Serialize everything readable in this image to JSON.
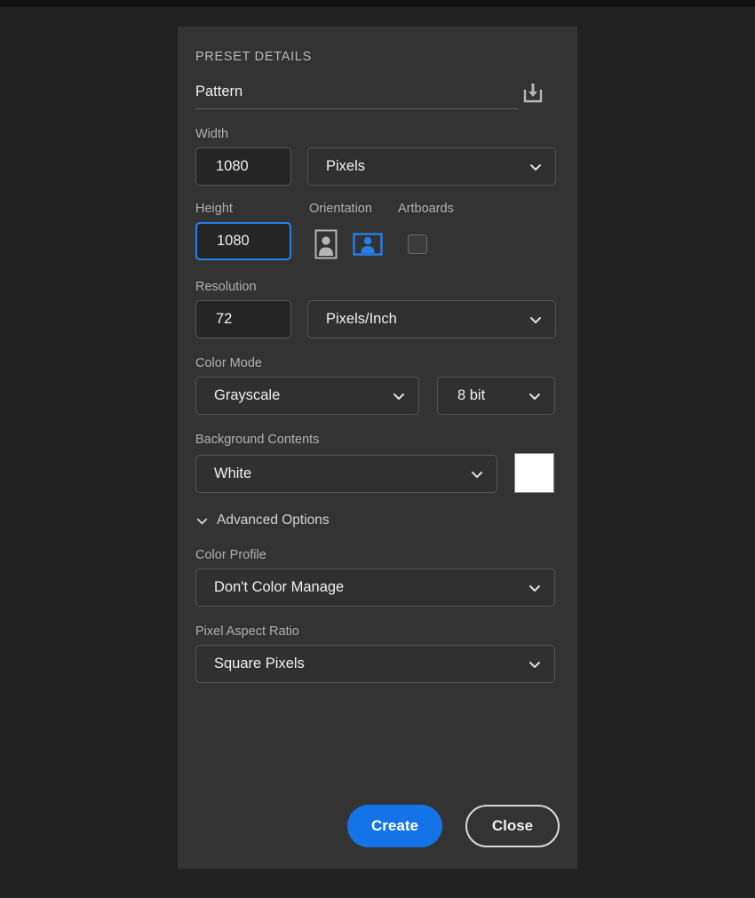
{
  "panel": {
    "section_title": "PRESET DETAILS",
    "preset_name": {
      "value": "Pattern",
      "save_icon": "save-preset-download-icon"
    },
    "width": {
      "label": "Width",
      "value": "1080",
      "unit": "Pixels"
    },
    "height": {
      "label": "Height",
      "value": "1080",
      "focused": true
    },
    "orientation": {
      "label": "Orientation",
      "portrait_icon": "portrait-orientation-icon",
      "landscape_icon": "landscape-orientation-icon",
      "selected": "landscape"
    },
    "artboards": {
      "label": "Artboards",
      "checked": false
    },
    "resolution": {
      "label": "Resolution",
      "value": "72",
      "unit": "Pixels/Inch"
    },
    "color_mode": {
      "label": "Color Mode",
      "value": "Grayscale",
      "depth": "8 bit"
    },
    "background_contents": {
      "label": "Background Contents",
      "value": "White",
      "swatch_color": "#ffffff"
    },
    "advanced_options": {
      "label": "Advanced Options",
      "expanded": true,
      "color_profile": {
        "label": "Color Profile",
        "value": "Don't Color Manage"
      },
      "pixel_aspect_ratio": {
        "label": "Pixel Aspect Ratio",
        "value": "Square Pixels"
      }
    },
    "footer": {
      "create_label": "Create",
      "close_label": "Close"
    }
  },
  "theme": {
    "app_background": "#212121",
    "panel_background": "#333333",
    "input_background": "#252525",
    "accent_blue": "#1473e6",
    "focus_blue": "#2680eb",
    "text_primary": "#f0f0f0",
    "text_label": "#b0b0b0"
  }
}
